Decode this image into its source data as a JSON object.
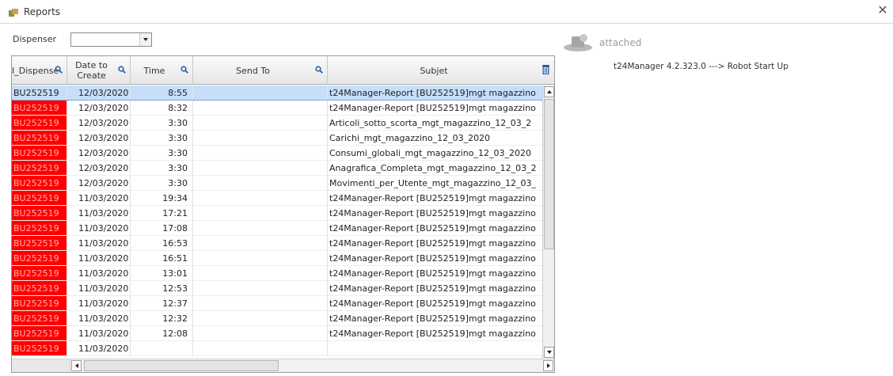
{
  "window": {
    "title": "Reports",
    "close_glyph": "✕"
  },
  "filter": {
    "label": "Dispenser",
    "value": ""
  },
  "grid": {
    "columns": {
      "dispenser": "I_Dispense",
      "date_line1": "Date to",
      "date_line2": "Create",
      "time": "Time",
      "send_to": "Send To",
      "subject": "Subjet"
    },
    "rows": [
      {
        "dispenser": "BU252519",
        "date": "12/03/2020",
        "time": "8:55",
        "send_to": "",
        "subject": "t24Manager-Report [BU252519]mgt magazzino",
        "selected": true,
        "red": false
      },
      {
        "dispenser": "BU252519",
        "date": "12/03/2020",
        "time": "8:32",
        "send_to": "",
        "subject": "t24Manager-Report [BU252519]mgt magazzino",
        "selected": false,
        "red": true
      },
      {
        "dispenser": "BU252519",
        "date": "12/03/2020",
        "time": "3:30",
        "send_to": "",
        "subject": "Articoli_sotto_scorta_mgt_magazzino_12_03_2",
        "selected": false,
        "red": true
      },
      {
        "dispenser": "BU252519",
        "date": "12/03/2020",
        "time": "3:30",
        "send_to": "",
        "subject": "Carichi_mgt_magazzino_12_03_2020",
        "selected": false,
        "red": true
      },
      {
        "dispenser": "BU252519",
        "date": "12/03/2020",
        "time": "3:30",
        "send_to": "",
        "subject": "Consumi_globali_mgt_magazzino_12_03_2020",
        "selected": false,
        "red": true
      },
      {
        "dispenser": "BU252519",
        "date": "12/03/2020",
        "time": "3:30",
        "send_to": "",
        "subject": "Anagrafica_Completa_mgt_magazzino_12_03_2",
        "selected": false,
        "red": true
      },
      {
        "dispenser": "BU252519",
        "date": "12/03/2020",
        "time": "3:30",
        "send_to": "",
        "subject": "Movimenti_per_Utente_mgt_magazzino_12_03_",
        "selected": false,
        "red": true
      },
      {
        "dispenser": "BU252519",
        "date": "11/03/2020",
        "time": "19:34",
        "send_to": "",
        "subject": "t24Manager-Report [BU252519]mgt magazzino",
        "selected": false,
        "red": true
      },
      {
        "dispenser": "BU252519",
        "date": "11/03/2020",
        "time": "17:21",
        "send_to": "",
        "subject": "t24Manager-Report [BU252519]mgt magazzino",
        "selected": false,
        "red": true
      },
      {
        "dispenser": "BU252519",
        "date": "11/03/2020",
        "time": "17:08",
        "send_to": "",
        "subject": "t24Manager-Report [BU252519]mgt magazzino",
        "selected": false,
        "red": true
      },
      {
        "dispenser": "BU252519",
        "date": "11/03/2020",
        "time": "16:53",
        "send_to": "",
        "subject": "t24Manager-Report [BU252519]mgt magazzino",
        "selected": false,
        "red": true
      },
      {
        "dispenser": "BU252519",
        "date": "11/03/2020",
        "time": "16:51",
        "send_to": "",
        "subject": "t24Manager-Report [BU252519]mgt magazzino",
        "selected": false,
        "red": true
      },
      {
        "dispenser": "BU252519",
        "date": "11/03/2020",
        "time": "13:01",
        "send_to": "",
        "subject": "t24Manager-Report [BU252519]mgt magazzino",
        "selected": false,
        "red": true
      },
      {
        "dispenser": "BU252519",
        "date": "11/03/2020",
        "time": "12:53",
        "send_to": "",
        "subject": "t24Manager-Report [BU252519]mgt magazzino",
        "selected": false,
        "red": true
      },
      {
        "dispenser": "BU252519",
        "date": "11/03/2020",
        "time": "12:37",
        "send_to": "",
        "subject": "t24Manager-Report [BU252519]mgt magazzino",
        "selected": false,
        "red": true
      },
      {
        "dispenser": "BU252519",
        "date": "11/03/2020",
        "time": "12:32",
        "send_to": "",
        "subject": "t24Manager-Report [BU252519]mgt magazzino",
        "selected": false,
        "red": true
      },
      {
        "dispenser": "BU252519",
        "date": "11/03/2020",
        "time": "12:08",
        "send_to": "",
        "subject": "t24Manager-Report [BU252519]mgt magazzino",
        "selected": false,
        "red": true
      },
      {
        "dispenser": "BU252519",
        "date": "11/03/2020",
        "time": "",
        "send_to": "",
        "subject": "",
        "selected": false,
        "red": true
      }
    ]
  },
  "attachments": {
    "label": "attached",
    "items": [
      "t24Manager 4.2.323.0 ---> Robot Start Up"
    ]
  },
  "colors": {
    "highlight_red": "#ff0000",
    "selection": "#c6defa"
  }
}
